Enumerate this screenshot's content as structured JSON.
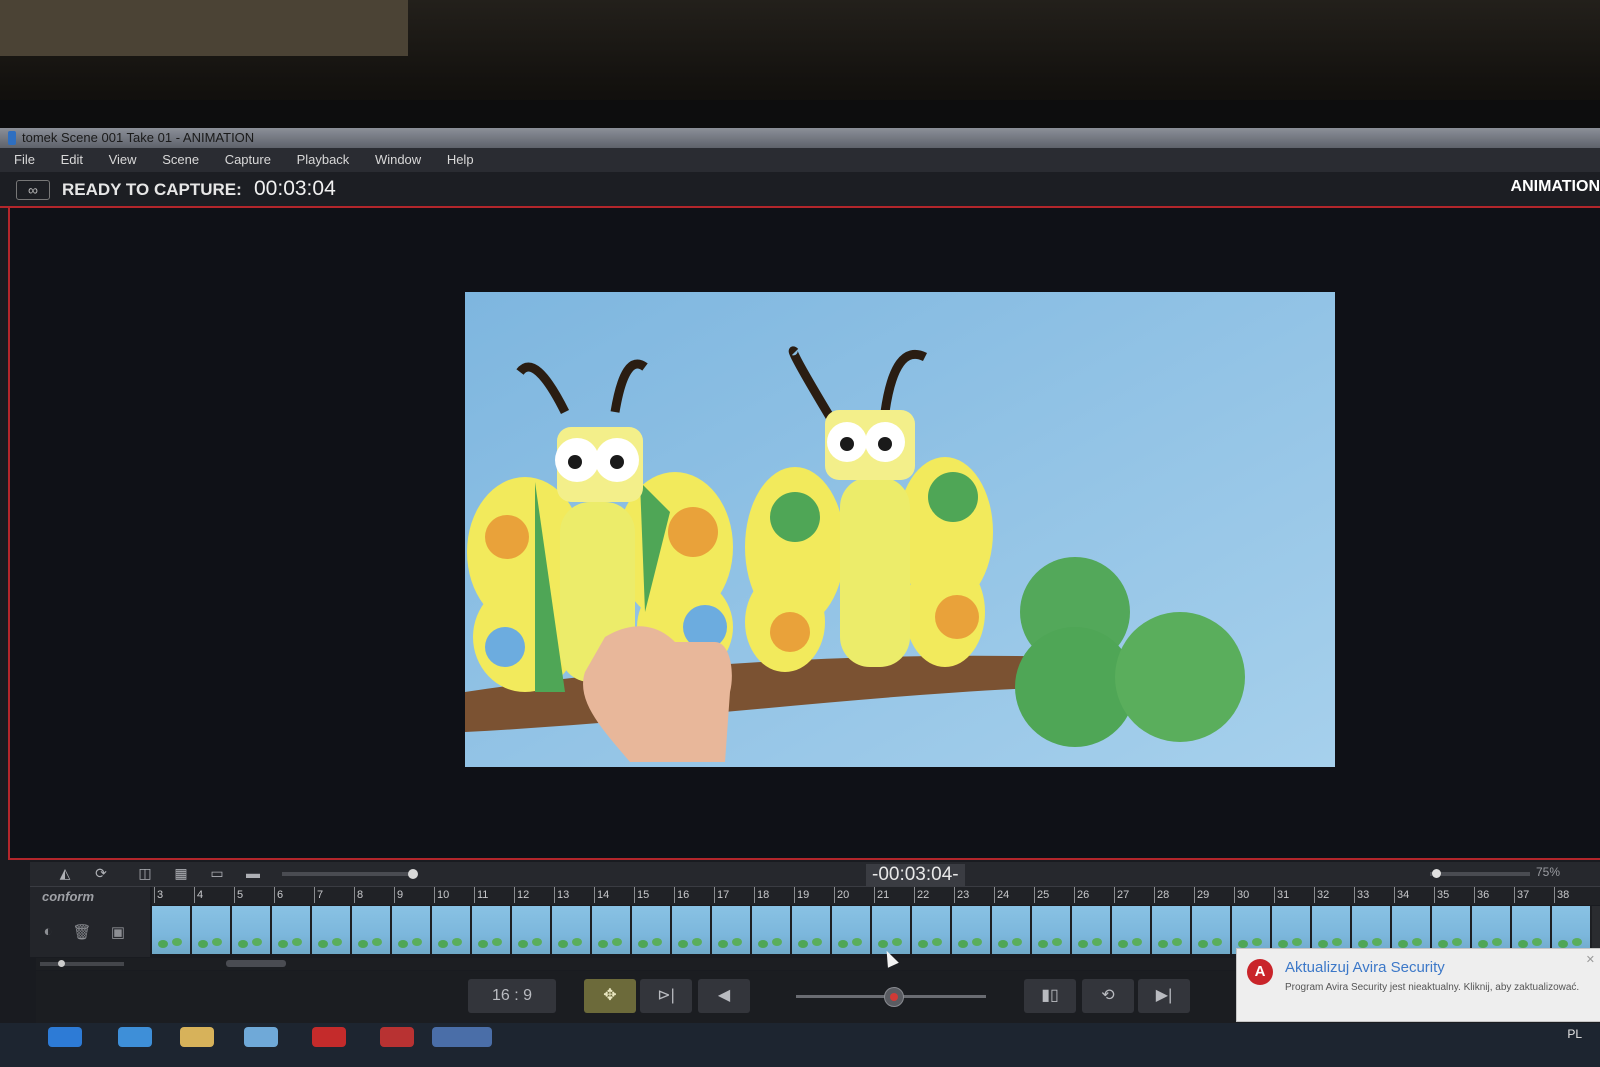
{
  "window": {
    "title": "tomek  Scene 001  Take 01 - ANIMATION"
  },
  "menu": [
    "File",
    "Edit",
    "View",
    "Scene",
    "Capture",
    "Playback",
    "Window",
    "Help"
  ],
  "status": {
    "loop_icon": "loop-icon",
    "label": "READY TO CAPTURE:",
    "time": "00:03:04",
    "mode": "ANIMATION"
  },
  "timeline": {
    "timecode": "-00:03:04-",
    "zoom": "75%",
    "track_label": "conform",
    "frame_numbers": [
      "3",
      "4",
      "5",
      "6",
      "7",
      "8",
      "9",
      "10",
      "11",
      "12",
      "13",
      "14",
      "15",
      "16",
      "17",
      "18",
      "19",
      "20",
      "21",
      "22",
      "23",
      "24",
      "25",
      "26",
      "27",
      "28",
      "29",
      "30",
      "31",
      "32",
      "33",
      "34",
      "35",
      "36",
      "37",
      "38"
    ]
  },
  "transport": {
    "aspect_label": "16 : 9"
  },
  "notification": {
    "title": "Aktualizuj Avira Security",
    "body": "Program Avira Security jest nieaktualny. Kliknij, aby zaktualizować.",
    "close": "✕"
  },
  "tray": {
    "language": "PL"
  },
  "colors": {
    "accent_red": "#b3262b",
    "sky": "#7cb7dc",
    "wing_yellow": "#f2ea5c",
    "leaf_green": "#4fa656"
  }
}
